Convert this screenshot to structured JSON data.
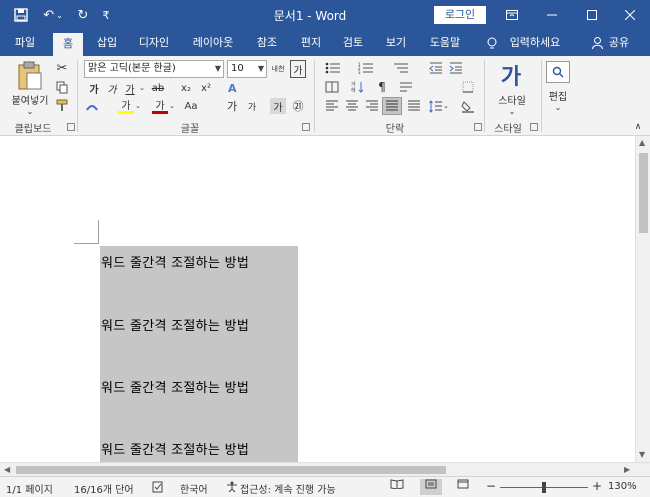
{
  "title_bar": {
    "doc_title": "문서1  -  Word",
    "login_label": "로그인",
    "qa_customize": "₹"
  },
  "tabs": [
    {
      "label": "파일"
    },
    {
      "label": "홈"
    },
    {
      "label": "삽입"
    },
    {
      "label": "디자인"
    },
    {
      "label": "레이아웃"
    },
    {
      "label": "참조"
    },
    {
      "label": "편지"
    },
    {
      "label": "검토"
    },
    {
      "label": "보기"
    },
    {
      "label": "도움말"
    }
  ],
  "tell_me": "입력하세요",
  "share": "공유",
  "ribbon": {
    "clipboard": {
      "paste_label": "붙여넣기",
      "group_label": "클립보드"
    },
    "font": {
      "font_name": "맑은 고딕(본문 한글)",
      "font_size": "10",
      "group_label": "글꼴",
      "bold": "가",
      "italic": "가",
      "underline": "가",
      "strike": "ab",
      "subscript": "x₂",
      "superscript": "x²",
      "grow": "가",
      "shrink": "가",
      "aa": "Aa",
      "highlight": "가",
      "color": "가",
      "char_shade": "가",
      "enclosed": "㉑",
      "phonetic": "내천",
      "clear": "가"
    },
    "paragraph": {
      "group_label": "단락"
    },
    "styles": {
      "button_label": "스타일",
      "group_label": "스타일",
      "glyph": "가"
    },
    "editing": {
      "button_label": "편집"
    }
  },
  "document": {
    "lines": [
      "워드 줄간격 조절하는 방법",
      "워드 줄간격 조절하는 방법",
      "워드 줄간격 조절하는 방법",
      "워드 줄간격 조절하는 방법"
    ]
  },
  "status": {
    "page": "1/1 페이지",
    "words": "16/16개 단어",
    "language": "한국어",
    "accessibility": "접근성: 계속 진행 가능",
    "zoom": "130%",
    "zoom_minus": "−",
    "zoom_plus": "+"
  }
}
